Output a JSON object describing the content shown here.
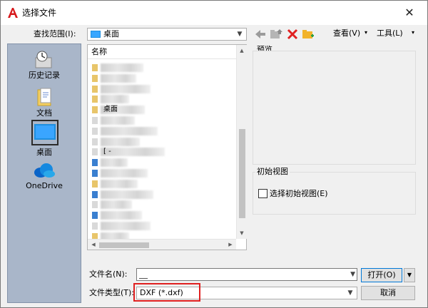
{
  "window": {
    "title": "选择文件",
    "close_glyph": "✕"
  },
  "toolbar": {
    "look_in_label": "查找范围(I):",
    "look_in_value": "桌面",
    "views_label": "查看(V)",
    "tools_label": "工具(L)",
    "back_icon": "back-arrow-icon",
    "up_icon": "up-folder-icon",
    "delete_icon": "delete-icon",
    "new_folder_icon": "new-folder-icon"
  },
  "places": [
    {
      "label": "历史记录",
      "icon": "history-icon"
    },
    {
      "label": "文档",
      "icon": "documents-icon"
    },
    {
      "label": "桌面",
      "icon": "desktop-icon"
    },
    {
      "label": "OneDrive",
      "icon": "onedrive-icon"
    }
  ],
  "filelist": {
    "column_name": "名称",
    "rows": [
      {
        "text": ""
      },
      {
        "text": ""
      },
      {
        "text": ""
      },
      {
        "text": ""
      },
      {
        "text": "桌面"
      },
      {
        "text": ""
      },
      {
        "text": ""
      },
      {
        "text": ""
      },
      {
        "text": "[ ‐"
      },
      {
        "text": ""
      },
      {
        "text": ""
      },
      {
        "text": ""
      },
      {
        "text": ""
      },
      {
        "text": ""
      },
      {
        "text": ""
      },
      {
        "text": ""
      },
      {
        "text": ""
      }
    ]
  },
  "preview": {
    "label": "预览"
  },
  "initial_view": {
    "group_label": "初始视图",
    "checkbox_label": "选择初始视图(E)",
    "checked": false
  },
  "filename": {
    "label": "文件名(N):",
    "value": ""
  },
  "filetype": {
    "label": "文件类型(T):",
    "value": "DXF (*.dxf)"
  },
  "buttons": {
    "open": "打开(O)",
    "cancel": "取消"
  },
  "colors": {
    "places_bg": "#a9b6c9",
    "highlight_box": "#e02020",
    "accent": "#0078d7"
  }
}
